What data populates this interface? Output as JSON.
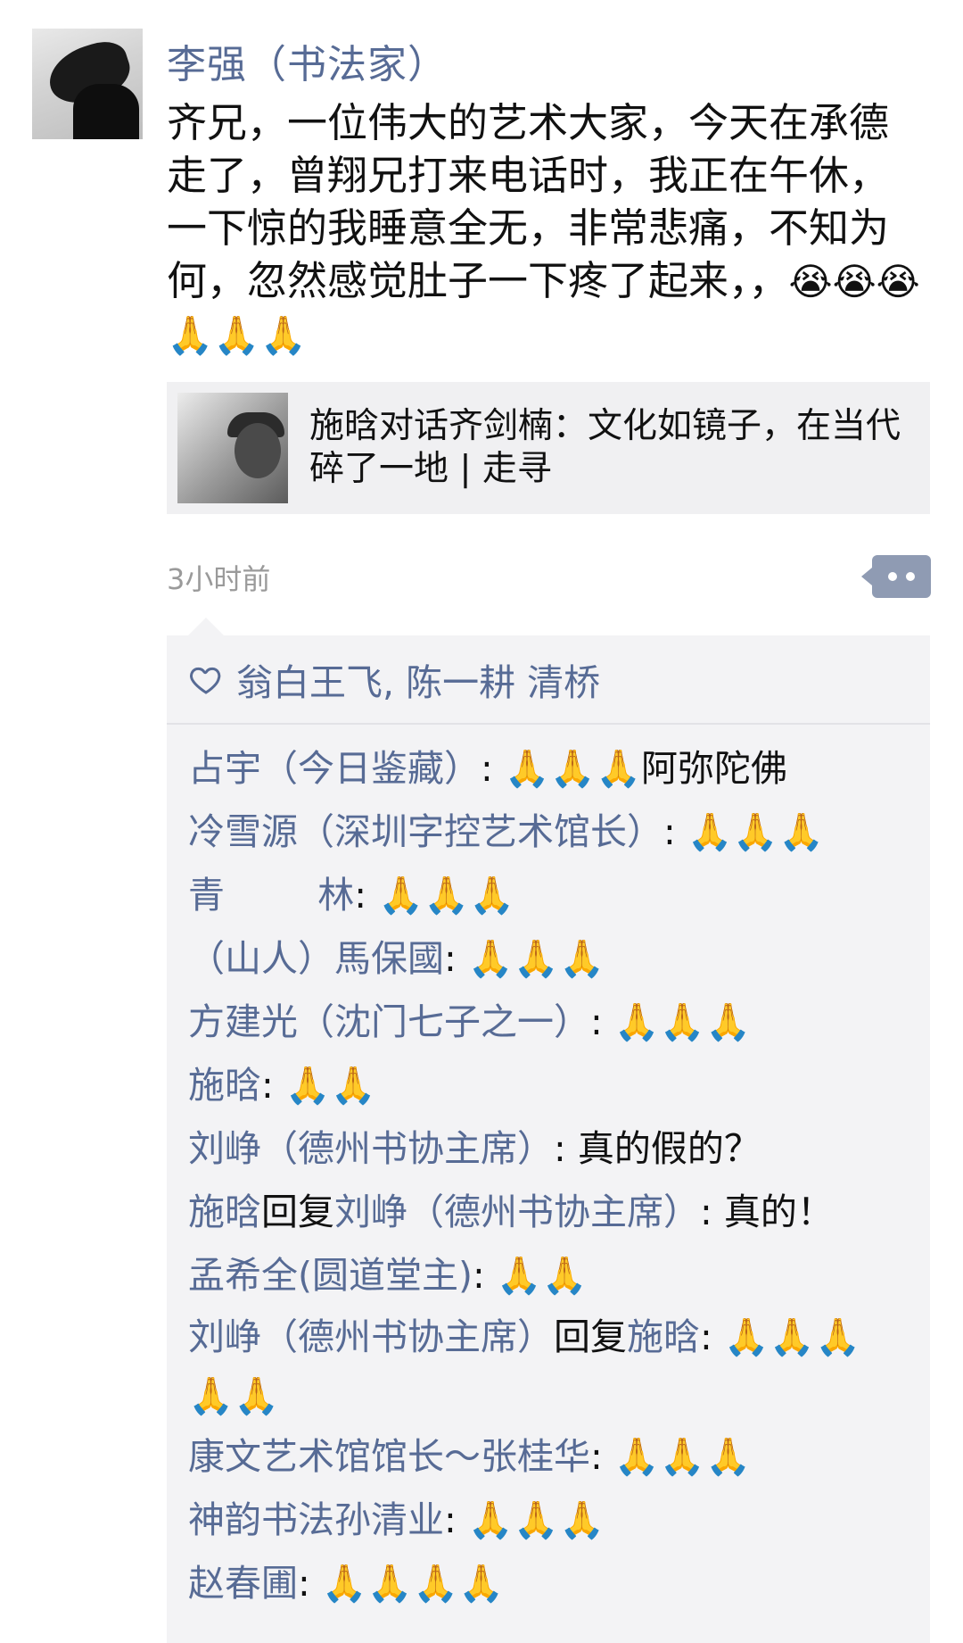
{
  "post": {
    "author": "李强（书法家）",
    "text": "齐兄，一位伟大的艺术大家，今天在承德走了，曾翔兄打来电话时，我正在午休，一下惊的我睡意全无，非常悲痛，不知为何，忽然感觉肚子一下疼了起来，，",
    "emojis": "😭😭😭🙏🙏🙏",
    "share_title": "施晗对话齐剑楠：文化如镜子，在当代碎了一地 | 走寻",
    "time": "3小时前"
  },
  "likes": {
    "names": "翁白王飞, 陈一耕   清桥"
  },
  "comments": [
    {
      "name": "占宇（今日鉴藏）",
      "text": "🙏🙏🙏阿弥陀佛"
    },
    {
      "name": "冷雪源（深圳字控艺术馆长）",
      "text": "🙏🙏🙏"
    },
    {
      "name": "青        林",
      "text": "🙏🙏🙏"
    },
    {
      "name": "（山人）馬保國",
      "text": "🙏🙏🙏"
    },
    {
      "name": "方建光（沈门七子之一）",
      "text": "🙏🙏🙏"
    },
    {
      "name": "施晗",
      "text": "🙏🙏"
    },
    {
      "name": "刘峥（德州书协主席）",
      "text": "真的假的？"
    },
    {
      "name": "施晗",
      "reply_word": "回复",
      "reply_to": "刘峥（德州书协主席）",
      "text": "真的！"
    },
    {
      "name": "孟希全(圆道堂主)",
      "text": "🙏🙏"
    },
    {
      "name": "刘峥（德州书协主席）",
      "reply_word": "回复",
      "reply_to": "施晗",
      "text": "🙏🙏🙏🙏🙏"
    },
    {
      "name": "康文艺术馆馆长～张桂华",
      "text": "🙏🙏🙏"
    },
    {
      "name": "神韵书法孙清业",
      "text": "🙏🙏🙏"
    },
    {
      "name": "赵春圃",
      "text": "🙏🙏🙏🙏"
    }
  ],
  "colors": {
    "link": "#576b95",
    "box_bg": "#f3f3f5",
    "more_btn": "#8f9bb3"
  },
  "icons": {
    "likes": "heart-outline-icon",
    "more": "more-dots-icon"
  }
}
